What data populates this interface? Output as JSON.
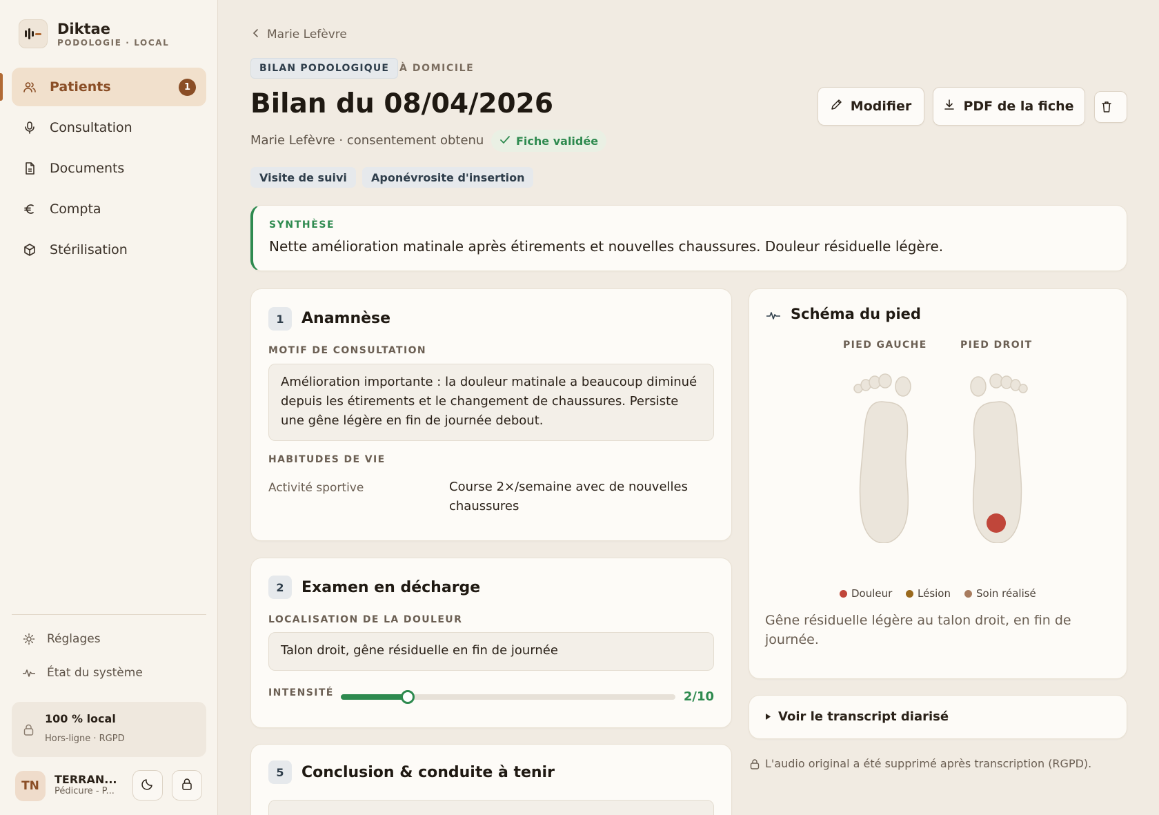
{
  "brand": {
    "name": "Diktae",
    "subtitle": "PODOLOGIE · LOCAL"
  },
  "nav": {
    "items": [
      {
        "label": "Patients",
        "icon": "users-icon",
        "badge": "1",
        "active": true
      },
      {
        "label": "Consultation",
        "icon": "microphone-icon"
      },
      {
        "label": "Documents",
        "icon": "document-icon"
      },
      {
        "label": "Compta",
        "icon": "euro-icon"
      },
      {
        "label": "Stérilisation",
        "icon": "box-icon"
      }
    ]
  },
  "sidebar_footer": {
    "settings": "Réglages",
    "system": "État du système",
    "local_title": "100 % local",
    "local_sub": "Hors-ligne · RGPD"
  },
  "user": {
    "initials": "TN",
    "name": "TERRAN...",
    "role": "Pédicure - P..."
  },
  "header": {
    "back": "Marie Lefèvre",
    "type_pill": "BILAN PODOLOGIQUE",
    "location": "À DOMICILE",
    "title": "Bilan du 08/04/2026",
    "subtitle": "Marie Lefèvre · consentement obtenu",
    "status": "Fiche validée",
    "tags": [
      "Visite de suivi",
      "Aponévrosite d'insertion"
    ]
  },
  "actions": {
    "edit": "Modifier",
    "pdf": "PDF de la fiche"
  },
  "synthesis": {
    "label": "SYNTHÈSE",
    "text": "Nette amélioration matinale après étirements et nouvelles chaussures. Douleur résiduelle légère."
  },
  "anamnese": {
    "num": "1",
    "title": "Anamnèse",
    "motif_label": "MOTIF DE CONSULTATION",
    "motif_text": "Amélioration importante : la douleur matinale a beaucoup diminué depuis les étirements et le changement de chaussures. Persiste une gêne légère en fin de journée debout.",
    "habits_label": "HABITUDES DE VIE",
    "habit_key": "Activité sportive",
    "habit_value": "Course 2×/semaine avec de nouvelles chaussures"
  },
  "examen": {
    "num": "2",
    "title": "Examen en décharge",
    "loc_label": "LOCALISATION DE LA DOULEUR",
    "loc_text": "Talon droit, gêne résiduelle en fin de journée",
    "intensity_label": "INTENSITÉ",
    "intensity_value": 2,
    "intensity_max": 10,
    "intensity_text": "2/10"
  },
  "conclusion": {
    "num": "5",
    "title": "Conclusion & conduite à tenir"
  },
  "foot_schema": {
    "title": "Schéma du pied",
    "left_label": "PIED GAUCHE",
    "right_label": "PIED DROIT",
    "legend": [
      {
        "label": "Douleur",
        "color": "#c0463a"
      },
      {
        "label": "Lésion",
        "color": "#9a6a1e"
      },
      {
        "label": "Soin réalisé",
        "color": "#a87c5f"
      }
    ],
    "note": "Gêne résiduelle légère au talon droit, en fin de journée."
  },
  "transcript": {
    "toggle": "Voir le transcript diarisé",
    "audio_note": "L'audio original a été supprimé après transcription (RGPD)."
  },
  "colors": {
    "accent": "#8a4e26",
    "success": "#2e8a4f",
    "pain": "#c0463a"
  }
}
